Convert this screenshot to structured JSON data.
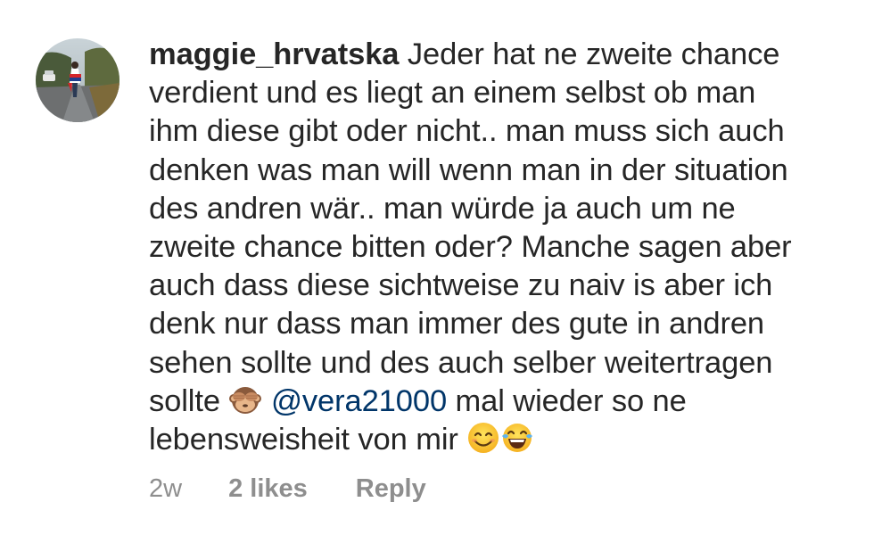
{
  "comment": {
    "username": "maggie_hrvatska",
    "lines": [
      "Jeder hat ne zweite chance",
      "verdient und es liegt an einem selbst ob man",
      "ihm diese gibt oder nicht.. man muss sich auch",
      "denken was man will wenn man in der situation",
      "des andren wär.. man würde ja auch um ne",
      "zweite chance bitten oder? Manche sagen aber",
      "auch dass diese sichtweise zu naiv is aber ich",
      "denk nur dass man immer des gute in andren",
      "sehen sollte und des auch selber weitertragen"
    ],
    "line10_before": "sollte",
    "line10_emoji": "see-no-evil-monkey-emoji",
    "mention": "@vera21000",
    "line10_after": "mal wieder so ne",
    "line11": "lebensweisheit von mir",
    "line11_emojis": [
      "smiling-face-emoji",
      "tears-of-joy-emoji"
    ]
  },
  "meta": {
    "time": "2w",
    "likes": "2 likes",
    "reply": "Reply"
  },
  "colors": {
    "text": "#262626",
    "secondary": "#8e8e8e",
    "mention": "#003569",
    "background": "#ffffff"
  }
}
